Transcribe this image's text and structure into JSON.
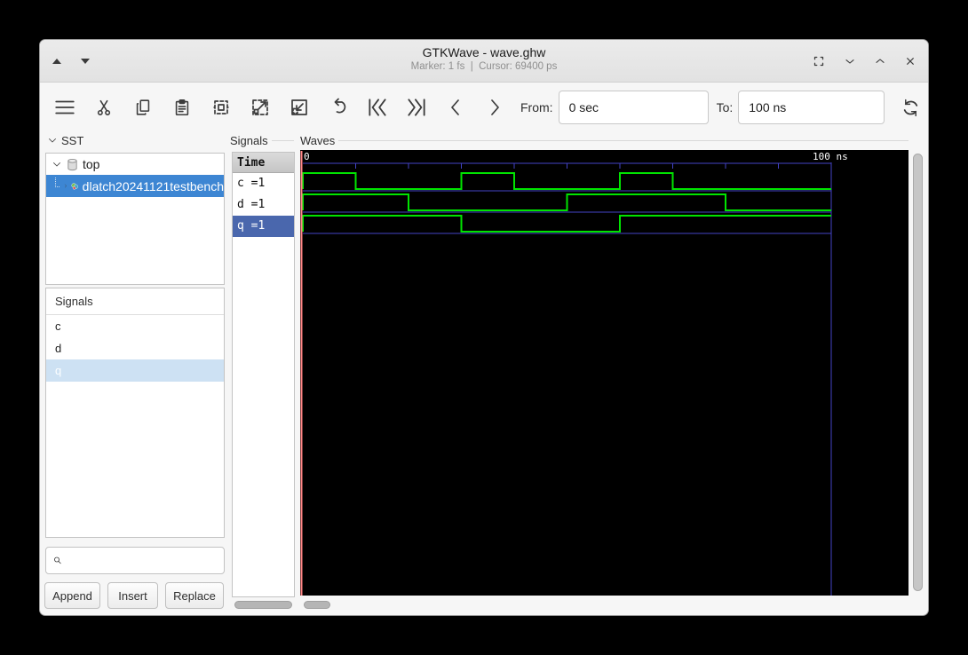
{
  "window": {
    "title": "GTKWave - wave.ghw",
    "status": "Marker: 1 fs  |  Cursor: 69400 ps"
  },
  "titlebar_icons": [
    "triangle-up",
    "triangle-down",
    "restore",
    "minimize-chevron-down",
    "maximize-chevron-up",
    "close-x"
  ],
  "toolbar": {
    "icons": [
      "menu",
      "cut",
      "copy",
      "paste",
      "zoom-fit",
      "zoom-in",
      "zoom-out",
      "zoom-undo",
      "to-start",
      "to-end",
      "back",
      "forward",
      "reload"
    ],
    "from_label": "From:",
    "from_value": "0 sec",
    "to_label": "To:",
    "to_value": "100 ns"
  },
  "sst": {
    "label": "SST",
    "items": [
      {
        "label": "top",
        "expanded": true,
        "icon": "cylinder"
      },
      {
        "label": "dlatch20241121testbench",
        "selected": true,
        "icon": "module-colored"
      }
    ]
  },
  "signal_search": {
    "label": "Signals",
    "items": [
      {
        "label": "c"
      },
      {
        "label": "d"
      },
      {
        "label": "q",
        "selected": true
      }
    ],
    "search_value": "",
    "buttons": {
      "append": "Append",
      "insert": "Insert",
      "replace": "Replace"
    }
  },
  "signal_list": {
    "label": "Signals",
    "time_header": "Time",
    "rows": [
      {
        "label": "c =1"
      },
      {
        "label": "d =1"
      },
      {
        "label": "q =1",
        "selected": true
      }
    ]
  },
  "waves": {
    "label": "Waves",
    "axis_start_label": "0",
    "axis_end_label": "100 ns",
    "chart_data": {
      "type": "digital-waveform",
      "time_unit": "ns",
      "x_range": [
        0,
        100
      ],
      "tick_interval_ns": 10,
      "marker_time_ns": 0,
      "signals": [
        {
          "name": "c",
          "initial": 1,
          "transitions": [
            {
              "t": 10,
              "v": 0
            },
            {
              "t": 30,
              "v": 1
            },
            {
              "t": 40,
              "v": 0
            },
            {
              "t": 60,
              "v": 1
            },
            {
              "t": 70,
              "v": 0
            }
          ]
        },
        {
          "name": "d",
          "initial": 1,
          "transitions": [
            {
              "t": 20,
              "v": 0
            },
            {
              "t": 50,
              "v": 1
            },
            {
              "t": 80,
              "v": 0
            }
          ]
        },
        {
          "name": "q",
          "initial": 1,
          "transitions": [
            {
              "t": 30,
              "v": 0
            },
            {
              "t": 60,
              "v": 1
            }
          ]
        }
      ]
    }
  },
  "colors": {
    "selection_blue": "#3d86d3",
    "list_selection_blue": "#4a67ad",
    "inactive_selection_blue": "#cde1f3",
    "wave_trace_green": "#00e400",
    "wave_grid_blue": "#4343c6",
    "marker_red": "#ff8585",
    "wave_background": "#000000"
  }
}
